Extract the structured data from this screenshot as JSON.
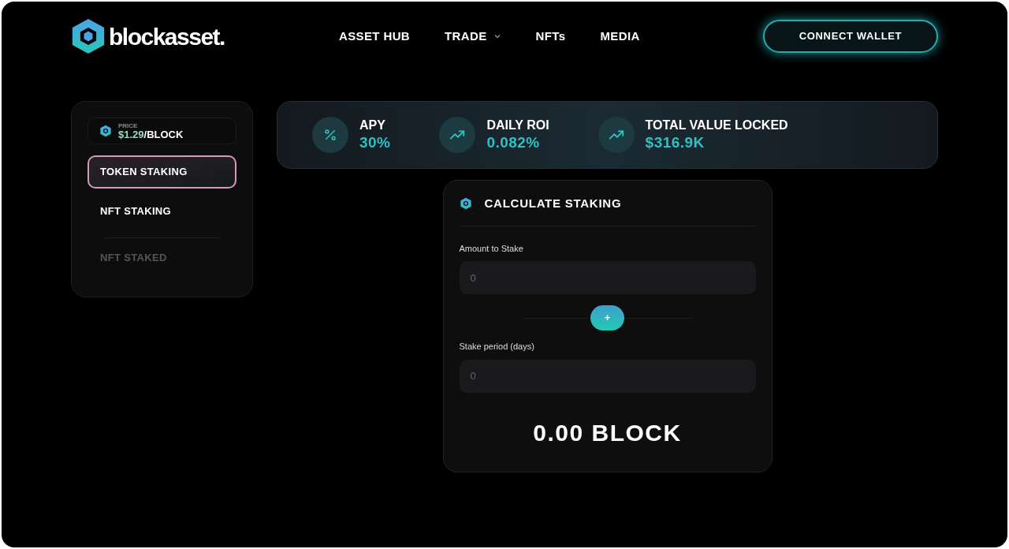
{
  "header": {
    "logo_text": "blockasset.",
    "nav": [
      {
        "label": "ASSET HUB",
        "dropdown": false
      },
      {
        "label": "TRADE",
        "dropdown": true
      },
      {
        "label": "NFTs",
        "dropdown": false
      },
      {
        "label": "MEDIA",
        "dropdown": false
      }
    ],
    "connect_button": "CONNECT WALLET"
  },
  "sidebar": {
    "price_label": "PRICE",
    "price_value": "$1.29",
    "price_unit": "/BLOCK",
    "items": [
      {
        "label": "TOKEN STAKING",
        "selected": true,
        "disabled": false
      },
      {
        "label": "NFT STAKING",
        "selected": false,
        "disabled": false
      },
      {
        "label": "NFT STAKED",
        "selected": false,
        "disabled": true
      }
    ]
  },
  "stats": [
    {
      "kind": "percent",
      "label": "APY",
      "value": "30%"
    },
    {
      "kind": "trend",
      "label": "DAILY ROI",
      "value": "0.082%"
    },
    {
      "kind": "trend",
      "label": "TOTAL VALUE LOCKED",
      "value": "$316.9K"
    }
  ],
  "calculator": {
    "title": "CALCULATE STAKING",
    "fields": [
      {
        "label": "Amount to Stake",
        "placeholder": "0"
      },
      {
        "label": "Stake period (days)",
        "placeholder": "0"
      }
    ],
    "plus_button": "+",
    "result": "0.00 BLOCK"
  }
}
